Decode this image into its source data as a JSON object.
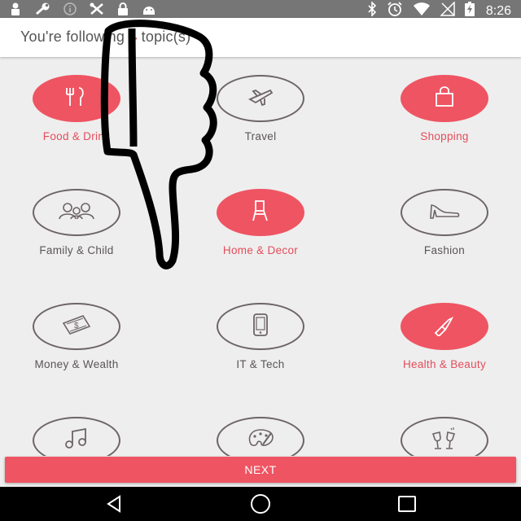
{
  "status_bar": {
    "time": "8:26",
    "left_icons": [
      "person-icon",
      "wrench-icon",
      "info-icon",
      "tools-icon",
      "lock-icon",
      "android-icon"
    ],
    "right_icons": [
      "bluetooth-icon",
      "alarm-icon",
      "wifi-icon",
      "signal-off-icon",
      "battery-charging-icon"
    ]
  },
  "header": {
    "prefix": "You're following ",
    "count": "4",
    "suffix": " topic(s)"
  },
  "topics": [
    {
      "label": "Food & Drink",
      "icon": "cutlery-icon",
      "selected": true
    },
    {
      "label": "Travel",
      "icon": "airplane-icon",
      "selected": false
    },
    {
      "label": "Shopping",
      "icon": "shopping-bag-icon",
      "selected": true
    },
    {
      "label": "Family & Child",
      "icon": "family-icon",
      "selected": false
    },
    {
      "label": "Home & Decor",
      "icon": "chair-icon",
      "selected": true
    },
    {
      "label": "Fashion",
      "icon": "high-heel-icon",
      "selected": false
    },
    {
      "label": "Money & Wealth",
      "icon": "money-icon",
      "selected": false
    },
    {
      "label": "IT & Tech",
      "icon": "phone-icon",
      "selected": false
    },
    {
      "label": "Health & Beauty",
      "icon": "lipstick-icon",
      "selected": true
    },
    {
      "label": "Music",
      "icon": "music-note-icon",
      "selected": false
    },
    {
      "label": "Art",
      "icon": "palette-icon",
      "selected": false
    },
    {
      "label": "Wine",
      "icon": "wine-glasses-icon",
      "selected": false
    }
  ],
  "next_button": {
    "label": "NEXT"
  },
  "nav_bar": {
    "items": [
      "back-icon",
      "home-icon",
      "recents-icon"
    ]
  },
  "colors": {
    "accent": "#ef5462",
    "statusbar": "#767676",
    "background": "#eeeeee"
  }
}
